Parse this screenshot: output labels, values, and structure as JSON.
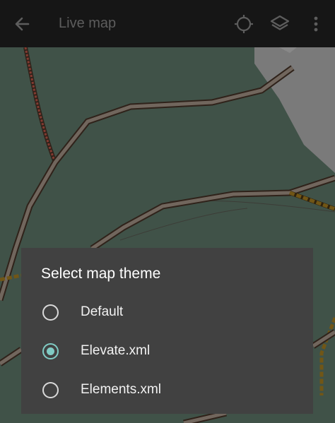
{
  "appbar": {
    "title": "Live map",
    "icons": [
      "arrow-back-icon",
      "crosshair-icon",
      "layers-icon",
      "more-vert-icon"
    ]
  },
  "dialog": {
    "title": "Select map theme",
    "options": [
      {
        "label": "Default",
        "selected": false
      },
      {
        "label": "Elevate.xml",
        "selected": true
      },
      {
        "label": "Elements.xml",
        "selected": false
      }
    ]
  },
  "colors": {
    "appbar": "#161616",
    "map_land": "#4f6558",
    "dialog": "#414141",
    "accent": "#80cbc4",
    "road_casing": "#3a2a20",
    "road_fill": "#8a7d72"
  }
}
